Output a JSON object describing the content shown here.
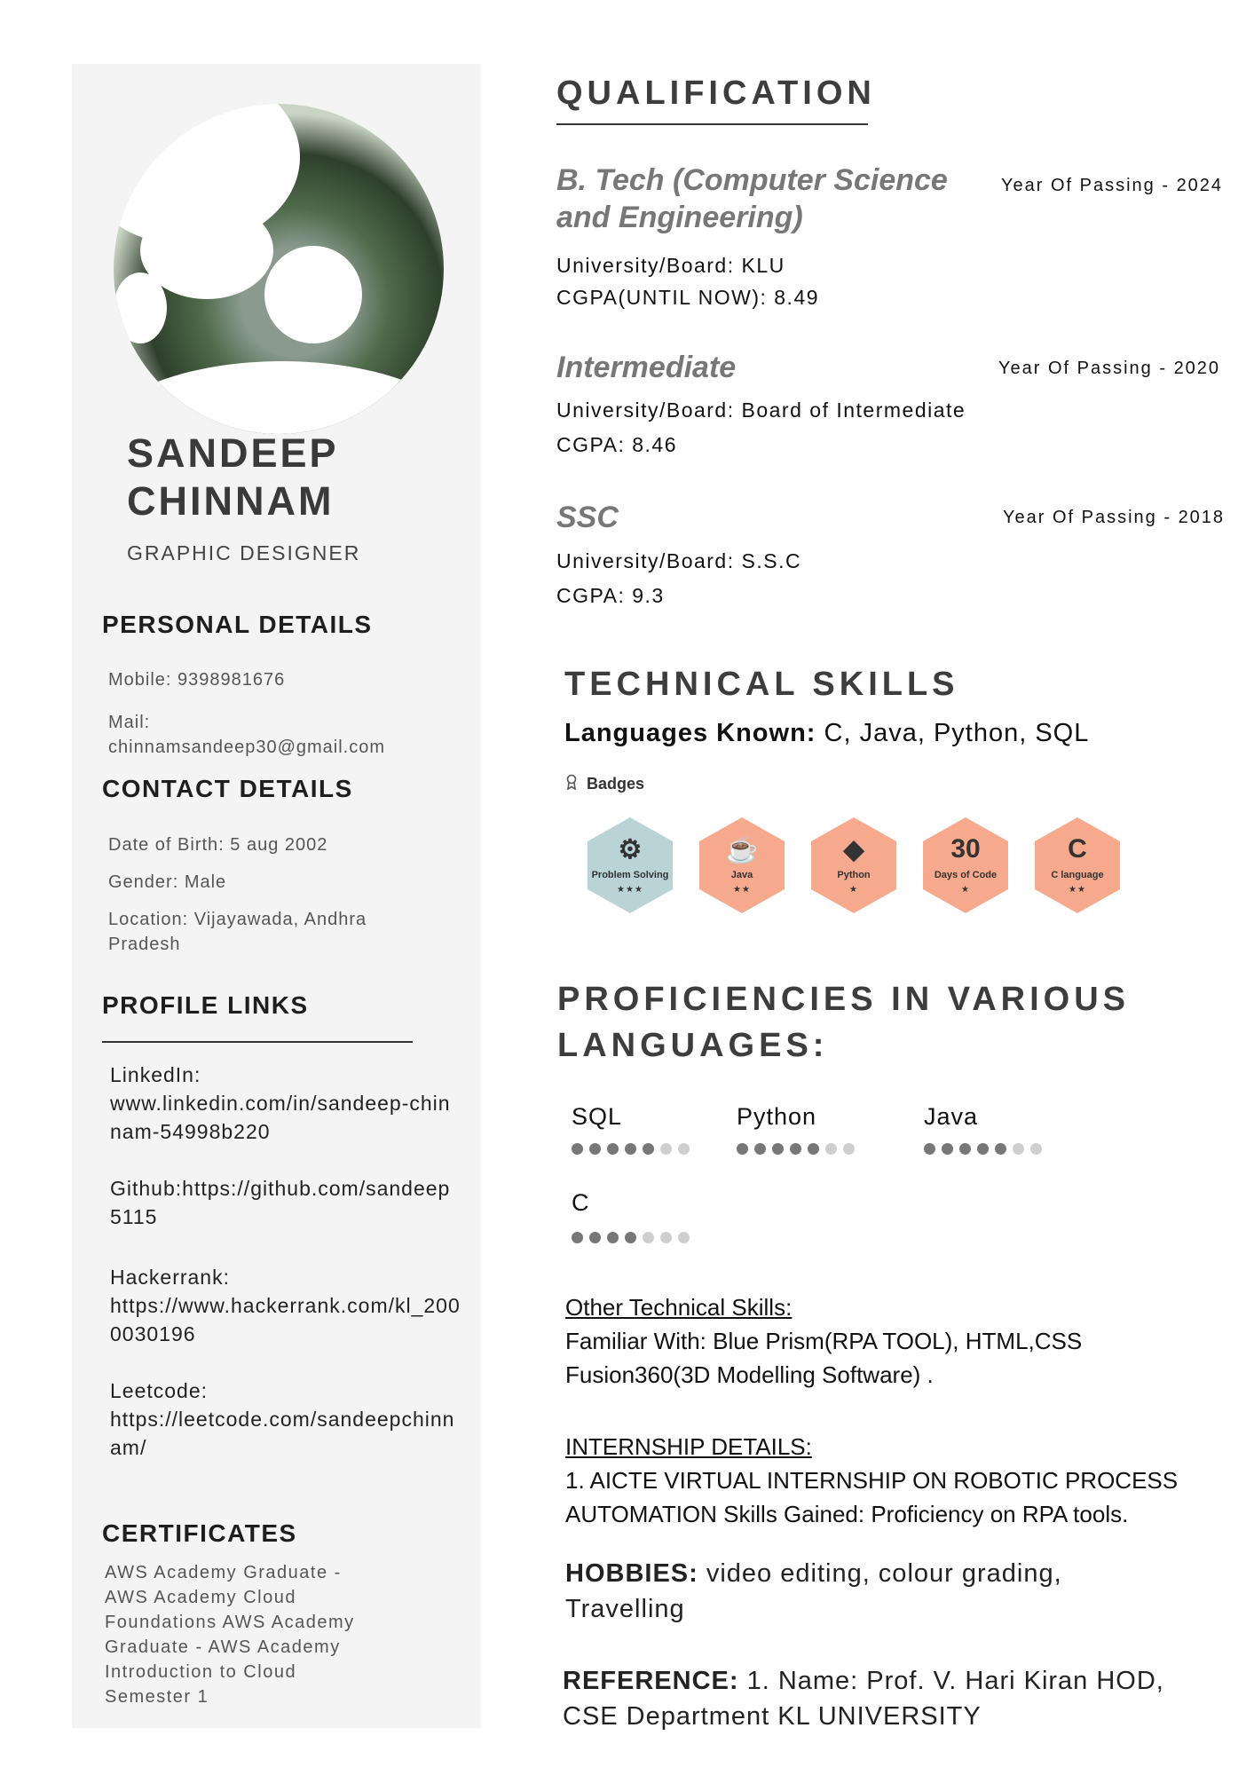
{
  "profile": {
    "name_line1": "SANDEEP",
    "name_line2": "CHINNAM",
    "role": "GRAPHIC DESIGNER"
  },
  "personal": {
    "heading": "PERSONAL DETAILS",
    "mobile": "Mobile: 9398981676",
    "mail_label": "Mail:",
    "mail_value": "chinnamsandeep30@gmail.com"
  },
  "contact": {
    "heading": "CONTACT DETAILS",
    "dob": "Date of Birth: 5 aug 2002",
    "gender": "Gender: Male",
    "location": "Location: Vijayawada, Andhra Pradesh"
  },
  "links": {
    "heading": "PROFILE LINKS",
    "linkedin_label": "LinkedIn:",
    "linkedin_url": "www.linkedin.com/in/sandeep-chinnam-54998b220",
    "github_label": "Github:",
    "github_url": "https://github.com/sandeep5115",
    "hackerrank_label": "Hackerrank:",
    "hackerrank_url": "https://www.hackerrank.com/kl_2000030196",
    "leetcode_label": "Leetcode:",
    "leetcode_url": "https://leetcode.com/sandeepchinnam/"
  },
  "certificates": {
    "heading": "CERTIFICATES",
    "text": "AWS Academy Graduate - AWS Academy Cloud Foundations AWS Academy Graduate - AWS Academy Introduction to Cloud Semester 1"
  },
  "qualification": {
    "heading": "QUALIFICATION",
    "items": [
      {
        "degree": "B. Tech (Computer Science and Engineering)",
        "year": "Year Of Passing - 2024",
        "board": "University/Board: KLU",
        "score": "CGPA(UNTIL NOW): 8.49"
      },
      {
        "degree": "Intermediate",
        "year": "Year Of Passing - 2020",
        "board": "University/Board: Board of Intermediate",
        "score": "CGPA: 8.46"
      },
      {
        "degree": "SSC",
        "year": "Year Of Passing - 2018",
        "board": "University/Board: S.S.C",
        "score": "CGPA: 9.3"
      }
    ]
  },
  "technical": {
    "heading": "TECHNICAL SKILLS",
    "languages_label": "Languages Known:",
    "languages_value": " C, Java, Python, SQL",
    "badges_title": "Badges",
    "badges": [
      {
        "icon": "⚙",
        "label": "Problem Solving",
        "stars": "★★★",
        "color": "#b9d3d6"
      },
      {
        "icon": "☕",
        "label": "Java",
        "stars": "★★",
        "color": "#f6a98c"
      },
      {
        "icon": "◆",
        "label": "Python",
        "stars": "★",
        "color": "#f6a98c"
      },
      {
        "icon": "30",
        "label": "Days of Code",
        "stars": "★",
        "color": "#f6a98c"
      },
      {
        "icon": "C",
        "label": "C language",
        "stars": "★★",
        "color": "#f6a98c"
      }
    ]
  },
  "proficiency": {
    "heading_line1": "PROFICIENCIES IN VARIOUS",
    "heading_line2": "LANGUAGES:",
    "items": [
      {
        "name": "SQL",
        "level": 5,
        "max": 7
      },
      {
        "name": "Python",
        "level": 5,
        "max": 7
      },
      {
        "name": "Java",
        "level": 5,
        "max": 7
      },
      {
        "name": "C",
        "level": 4,
        "max": 7
      }
    ]
  },
  "other": {
    "heading": "Other Technical Skills:",
    "line1": "Familiar With:  Blue Prism(RPA TOOL), HTML,CSS",
    "line2": "Fusion360(3D Modelling Software) ."
  },
  "internship": {
    "heading": "INTERNSHIP DETAILS:",
    "text": "1. AICTE VIRTUAL INTERNSHIP ON ROBOTIC PROCESS AUTOMATION Skills Gained: Proficiency on RPA tools."
  },
  "hobbies": {
    "label": "HOBBIES:",
    "value": " video editing, colour grading, Travelling"
  },
  "reference": {
    "label": "REFERENCE:",
    "value": "  1. Name: Prof. V. Hari Kiran HOD, CSE Department KL UNIVERSITY"
  }
}
